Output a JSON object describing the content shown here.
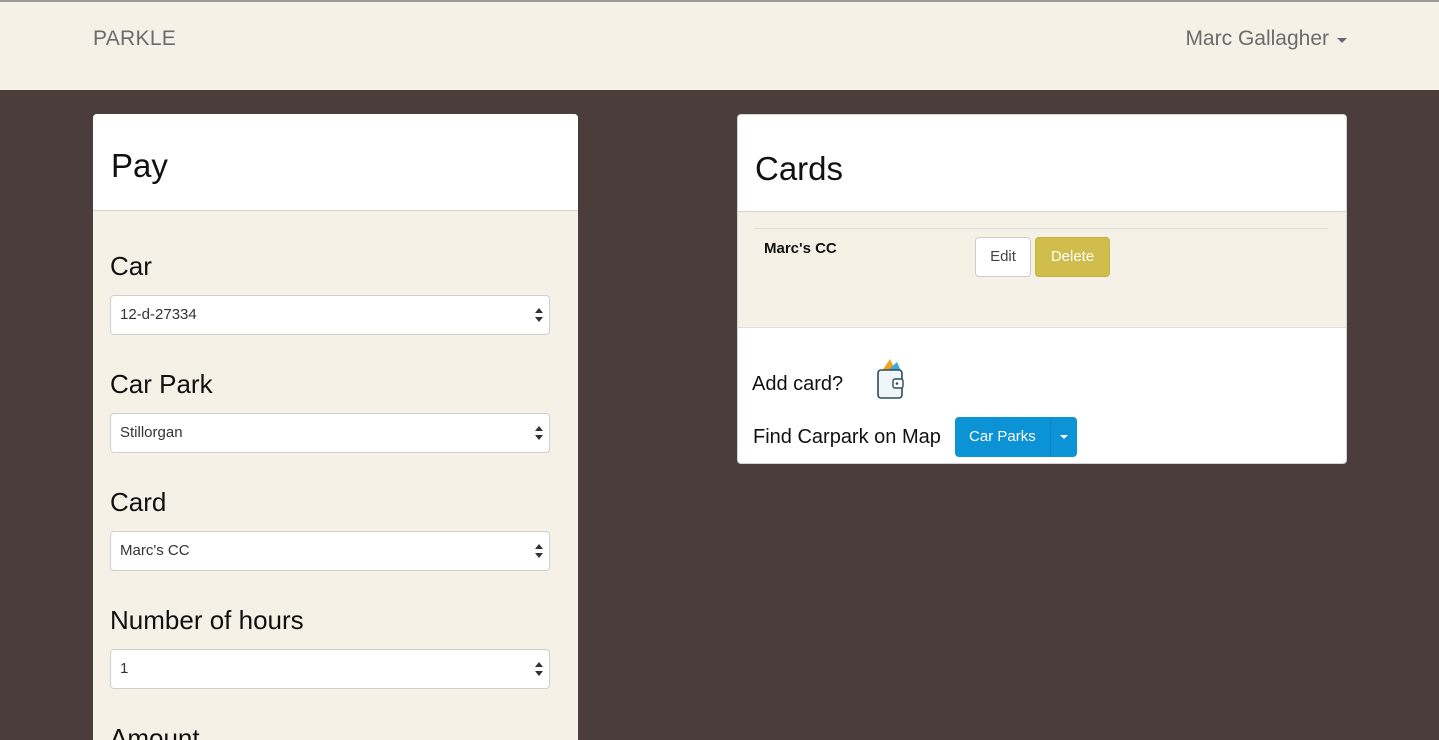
{
  "navbar": {
    "brand": "PARKLE",
    "user": "Marc Gallagher"
  },
  "pay": {
    "title": "Pay",
    "fields": [
      {
        "label": "Car",
        "value": "12-d-27334"
      },
      {
        "label": "Car Park",
        "value": "Stillorgan"
      },
      {
        "label": "Card",
        "value": "Marc's CC"
      },
      {
        "label": "Number of hours",
        "value": "1"
      }
    ],
    "amount_label": "Amount"
  },
  "cards": {
    "title": "Cards",
    "items": [
      {
        "name": "Marc's CC",
        "edit_label": "Edit",
        "delete_label": "Delete"
      }
    ],
    "add_label": "Add card?",
    "find_label": "Find Carpark on Map",
    "carparks_button": "Car Parks"
  },
  "colors": {
    "background": "#4a3d3b",
    "navbar": "#f6f1e7",
    "delete": "#d0bd4c",
    "primary": "#0b93d6"
  },
  "icons": {
    "wallet": "wallet-icon",
    "select_arrows": "sort-arrows-icon",
    "dropdown": "caret-down-icon"
  }
}
